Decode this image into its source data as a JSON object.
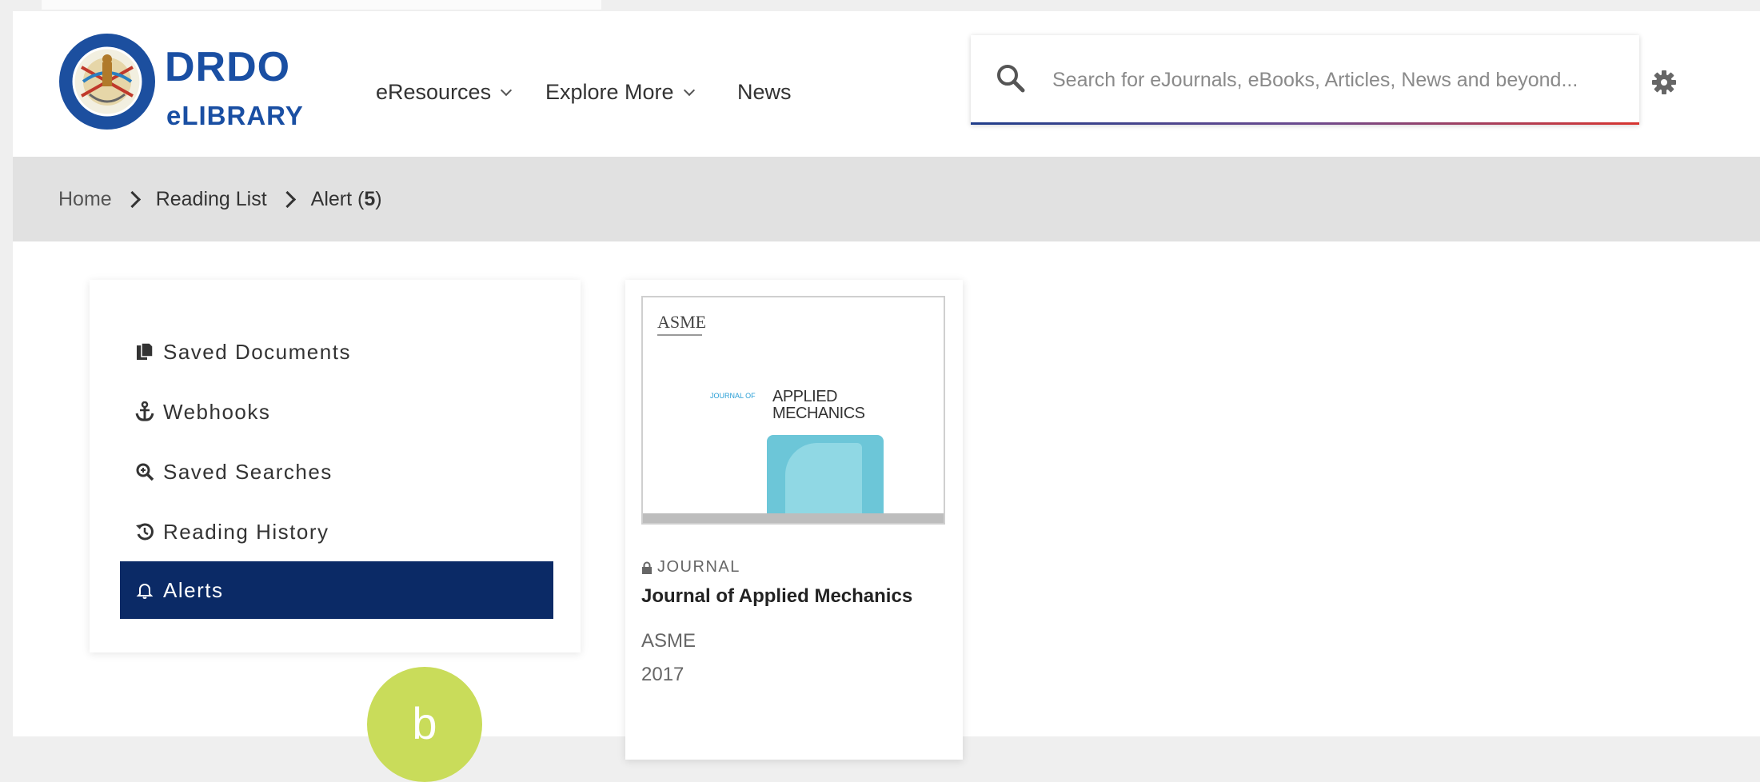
{
  "brand": {
    "title": "DRDO",
    "subtitle": "eLIBRARY",
    "accent": "#1a4fa3"
  },
  "nav": {
    "items": [
      {
        "label": "eResources",
        "dropdown": true
      },
      {
        "label": "Explore More",
        "dropdown": true
      },
      {
        "label": "News",
        "dropdown": false
      }
    ]
  },
  "search": {
    "placeholder": "Search for eJournals, eBooks, Articles, News and beyond...",
    "value": ""
  },
  "breadcrumb": {
    "home": "Home",
    "reading_list": "Reading List",
    "current": "Alert (",
    "count": "5",
    "close": ")"
  },
  "sidebar": {
    "items": [
      {
        "label": "Saved Documents",
        "icon": "documents-icon",
        "active": false
      },
      {
        "label": "Webhooks",
        "icon": "anchor-icon",
        "active": false
      },
      {
        "label": "Saved Searches",
        "icon": "search-plus-icon",
        "active": false
      },
      {
        "label": "Reading History",
        "icon": "history-icon",
        "active": false
      },
      {
        "label": "Alerts",
        "icon": "bell-icon",
        "active": true
      }
    ],
    "active_color": "#0b2a66"
  },
  "card": {
    "cover": {
      "brand": "ASME",
      "journal_tag": "JOURNAL OF",
      "title_line1": "APPLIED",
      "title_line2": "MECHANICS"
    },
    "type": "JOURNAL",
    "title": "Journal of Applied Mechanics",
    "publisher": "ASME",
    "year": "2017"
  },
  "badge": {
    "letter": "b",
    "color": "#c9dc5a"
  }
}
